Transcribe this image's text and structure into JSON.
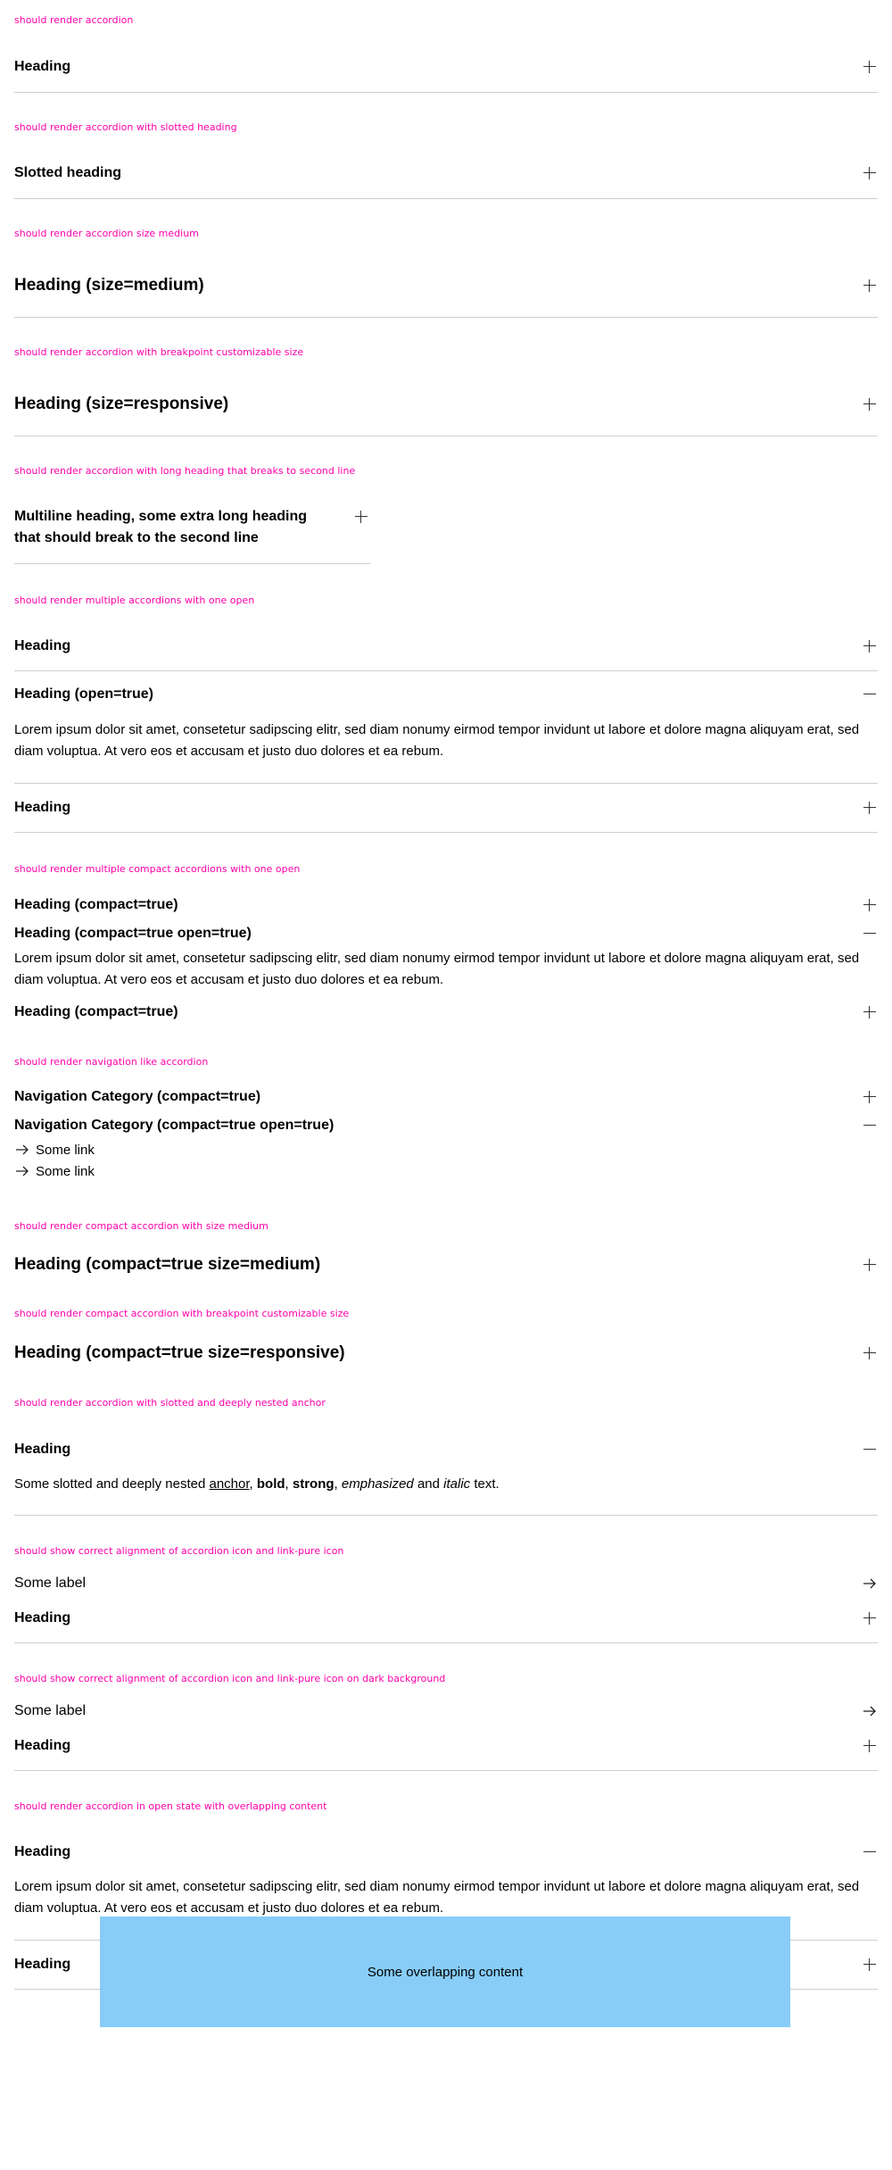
{
  "sections": {
    "s1": {
      "caption": "should render accordion",
      "heading": "Heading"
    },
    "s2": {
      "caption": "should render accordion with slotted heading",
      "heading": "Slotted heading"
    },
    "s3": {
      "caption": "should render accordion size medium",
      "heading": "Heading (size=medium)"
    },
    "s4": {
      "caption": "should render accordion with breakpoint customizable size",
      "heading": "Heading (size=responsive)"
    },
    "s5": {
      "caption": "should render accordion with long heading that breaks to second line",
      "heading": "Multiline heading, some extra long heading that should break to the second line"
    },
    "s6": {
      "caption": "should render multiple accordions with one open",
      "heading1": "Heading",
      "heading2": "Heading (open=true)",
      "content": "Lorem ipsum dolor sit amet, consetetur sadipscing elitr, sed diam nonumy eirmod tempor invidunt ut labore et dolore magna aliquyam erat, sed diam voluptua. At vero eos et accusam et justo duo dolores et ea rebum.",
      "heading3": "Heading"
    },
    "s7": {
      "caption": "should render multiple compact accordions with one open",
      "heading1": "Heading (compact=true)",
      "heading2": "Heading (compact=true open=true)",
      "content": "Lorem ipsum dolor sit amet, consetetur sadipscing elitr, sed diam nonumy eirmod tempor invidunt ut labore et dolore magna aliquyam erat, sed diam voluptua. At vero eos et accusam et justo duo dolores et ea rebum.",
      "heading3": "Heading (compact=true)"
    },
    "s8": {
      "caption": "should render navigation like accordion",
      "heading1": "Navigation Category (compact=true)",
      "heading2": "Navigation Category (compact=true open=true)",
      "links": [
        "Some link",
        "Some link"
      ]
    },
    "s9": {
      "caption": "should render compact accordion with size medium",
      "heading": "Heading (compact=true size=medium)"
    },
    "s10": {
      "caption": "should render compact accordion with breakpoint customizable size",
      "heading": "Heading (compact=true size=responsive)"
    },
    "s11": {
      "caption": "should render accordion with slotted and deeply nested anchor",
      "heading": "Heading",
      "text_prefix": "Some slotted and deeply nested ",
      "anchor": "anchor",
      "sep1": ", ",
      "bold": "bold",
      "sep2": ", ",
      "strong": "strong",
      "sep3": ", ",
      "emphasized": "emphasized",
      "sep4": " and ",
      "italic": "italic",
      "suffix": " text."
    },
    "s12": {
      "caption": "should show correct alignment of accordion icon and link-pure icon",
      "link_label": "Some label",
      "heading": "Heading"
    },
    "s13": {
      "caption": "should show correct alignment of accordion icon and link-pure icon on dark background",
      "link_label": "Some label",
      "heading": "Heading"
    },
    "s14": {
      "caption": "should render accordion in open state with overlapping content",
      "heading1": "Heading",
      "content": "Lorem ipsum dolor sit amet, consetetur sadipscing elitr, sed diam nonumy eirmod tempor invidunt ut labore et dolore magna aliquyam erat, sed diam voluptua. At vero eos et accusam et justo duo dolores et ea rebum.",
      "heading2": "Heading",
      "overlap": "Some overlapping content"
    }
  },
  "icons": {
    "expand": "plus-icon",
    "collapse": "minus-icon",
    "link": "arrow-right-icon"
  },
  "colors": {
    "caption": "#ff00aa",
    "divider": "#cfcfd1",
    "overlap_bg": "#87cdf8"
  }
}
